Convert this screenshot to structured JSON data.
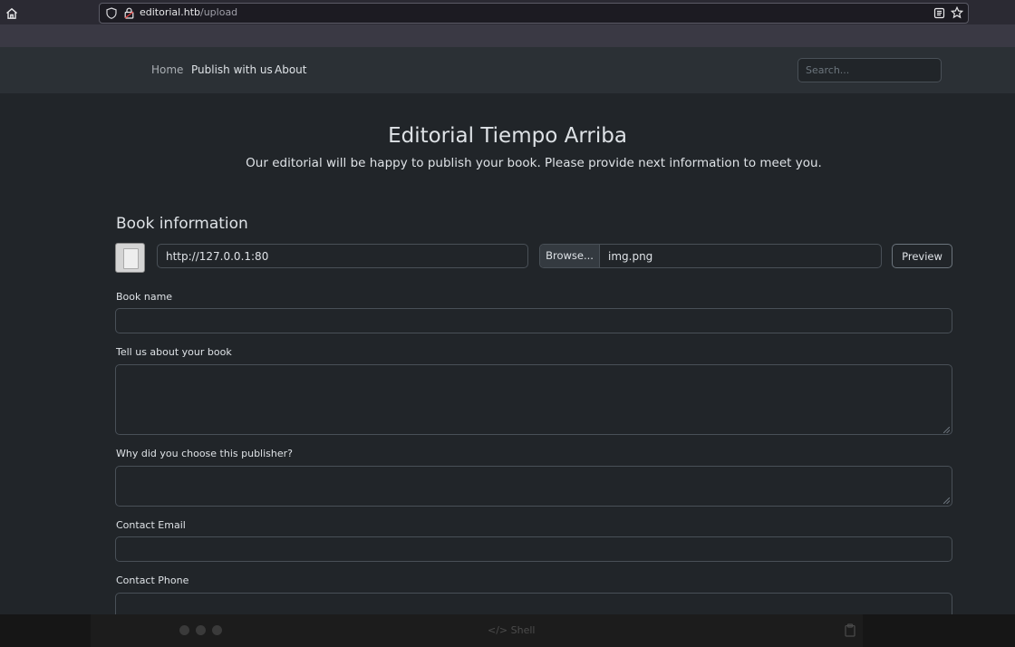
{
  "browser": {
    "url_host": "editorial.htb",
    "url_path": "/upload",
    "icons": [
      "home-icon",
      "shield-icon",
      "lock-icon",
      "reader-view-icon",
      "bookmark-star-icon"
    ]
  },
  "nav": {
    "links": [
      "Home",
      "Publish with us",
      "About"
    ],
    "search_placeholder": "Search..."
  },
  "header": {
    "title": "Editorial Tiempo Arriba",
    "subtitle": "Our editorial will be happy to publish your book. Please provide next information to meet you."
  },
  "form": {
    "section_title": "Book information",
    "cover_url_value": "http://127.0.0.1:80",
    "browse_label": "Browse...",
    "file_name": "img.png",
    "preview_label": "Preview",
    "fields": {
      "book_name_label": "Book name",
      "about_label": "Tell us about your book",
      "why_label": "Why did you choose this publisher?",
      "email_label": "Contact Email",
      "phone_label": "Contact Phone"
    }
  },
  "bottom_bar": {
    "shell_label": "</> Shell"
  },
  "colors": {
    "page_bg": "#212529",
    "navbar_bg": "#2b3035",
    "text": "#dee2e6",
    "border": "#495057"
  }
}
